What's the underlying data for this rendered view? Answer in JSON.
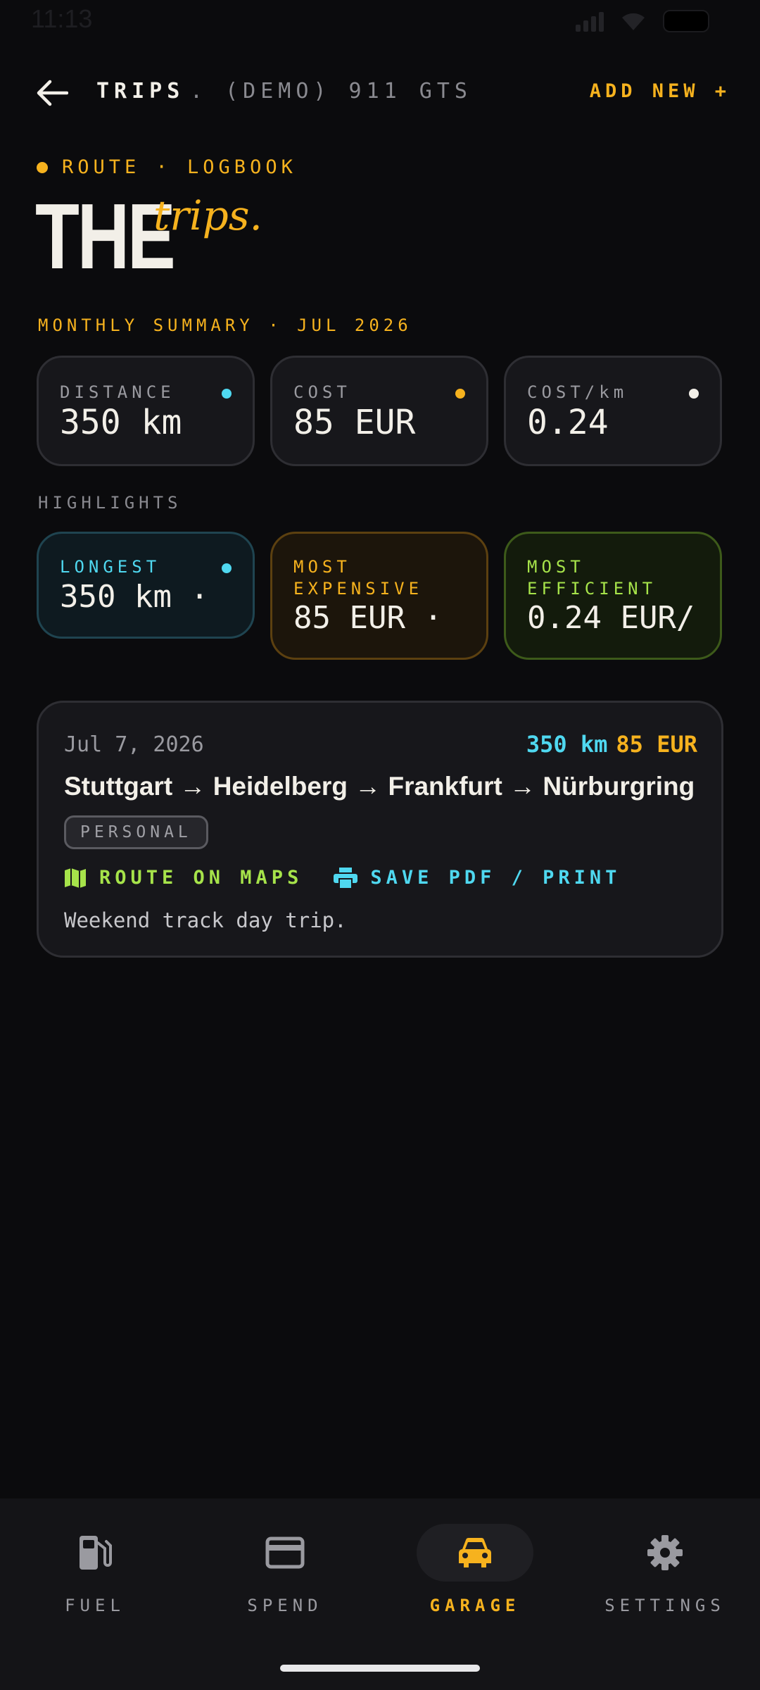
{
  "status_bar": {
    "time": "11:13"
  },
  "header": {
    "title": "TRIPS",
    "subtitle": ". (DEMO) 911 GTS",
    "add_new": "ADD NEW +"
  },
  "hero": {
    "kicker": "ROUTE · LOGBOOK",
    "title_main": "THE",
    "title_script": "trips."
  },
  "monthly_summary": {
    "label": "MONTHLY SUMMARY · JUL 2026",
    "cards": [
      {
        "label": "DISTANCE",
        "value": "350 km",
        "dot_color": "#4fd8f0"
      },
      {
        "label": "COST",
        "value": "85 EUR",
        "dot_color": "#f6b21e"
      },
      {
        "label": "COST/km",
        "value": "0.24",
        "dot_color": "#f2efe8"
      }
    ]
  },
  "highlights": {
    "label": "HIGHLIGHTS",
    "cards": [
      {
        "label": "LONGEST",
        "value": "350 km ·",
        "accent": "#4fd8f0"
      },
      {
        "label_line1": "MOST",
        "label_line2": "EXPENSIVE",
        "value": "85 EUR ·",
        "accent": "#f6b21e"
      },
      {
        "label_line1": "MOST",
        "label_line2": "EFFICIENT",
        "value": "0.24 EUR/",
        "accent": "#a6e34a"
      }
    ]
  },
  "trips": [
    {
      "date": "Jul 7, 2026",
      "distance": "350 km",
      "cost": "85 EUR",
      "route": "Stuttgart → Heidelberg → Frankfurt → Nürburgring",
      "tag": "PERSONAL",
      "action_maps": "ROUTE ON MAPS",
      "action_pdf": "SAVE PDF / PRINT",
      "note": "Weekend track day trip."
    }
  ],
  "bottom_nav": [
    {
      "label": "FUEL",
      "icon": "fuel-pump-icon"
    },
    {
      "label": "SPEND",
      "icon": "credit-card-icon"
    },
    {
      "label": "GARAGE",
      "icon": "car-icon",
      "active": true
    },
    {
      "label": "SETTINGS",
      "icon": "gear-icon"
    }
  ],
  "colors": {
    "accent": "#f6b21e",
    "cyan": "#4fd8f0",
    "green": "#a6e34a",
    "background": "#0b0b0d"
  }
}
